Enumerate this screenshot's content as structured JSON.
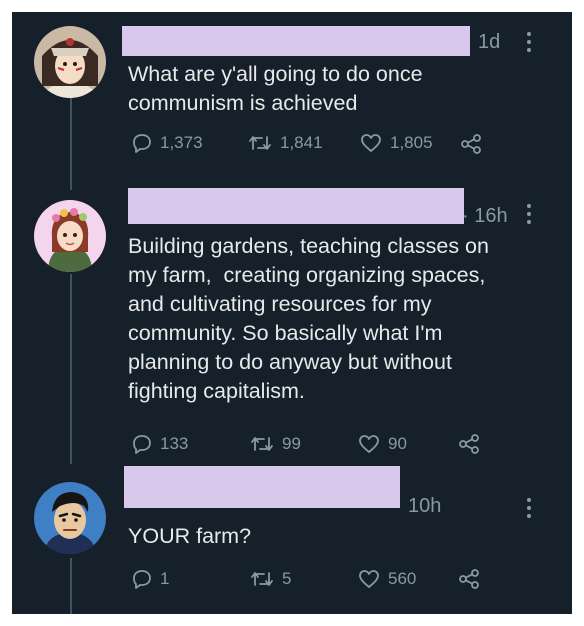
{
  "tweets": [
    {
      "time": "1d",
      "text": "What are y'all going to do once\ncommunism is achieved",
      "replies": "1,373",
      "retweets": "1,841",
      "likes": "1,805"
    },
    {
      "time": "· 16h",
      "text": "Building gardens, teaching classes on\nmy farm,  creating organizing spaces,\nand cultivating resources for my\ncommunity. So basically what I'm\nplanning to do anyway but without\nfighting capitalism.",
      "replies": "133",
      "retweets": "99",
      "likes": "90"
    },
    {
      "time": "10h",
      "text": "YOUR farm?",
      "replies": "1",
      "retweets": "5",
      "likes": "560"
    }
  ],
  "colors": {
    "background": "#15202b",
    "text": "#e7e9ea",
    "muted": "#8899a6",
    "redaction": "#d8c9ec",
    "thread_line": "#3d5466"
  },
  "icons": [
    "reply-icon",
    "retweet-icon",
    "like-icon",
    "share-icon",
    "more-icon"
  ]
}
